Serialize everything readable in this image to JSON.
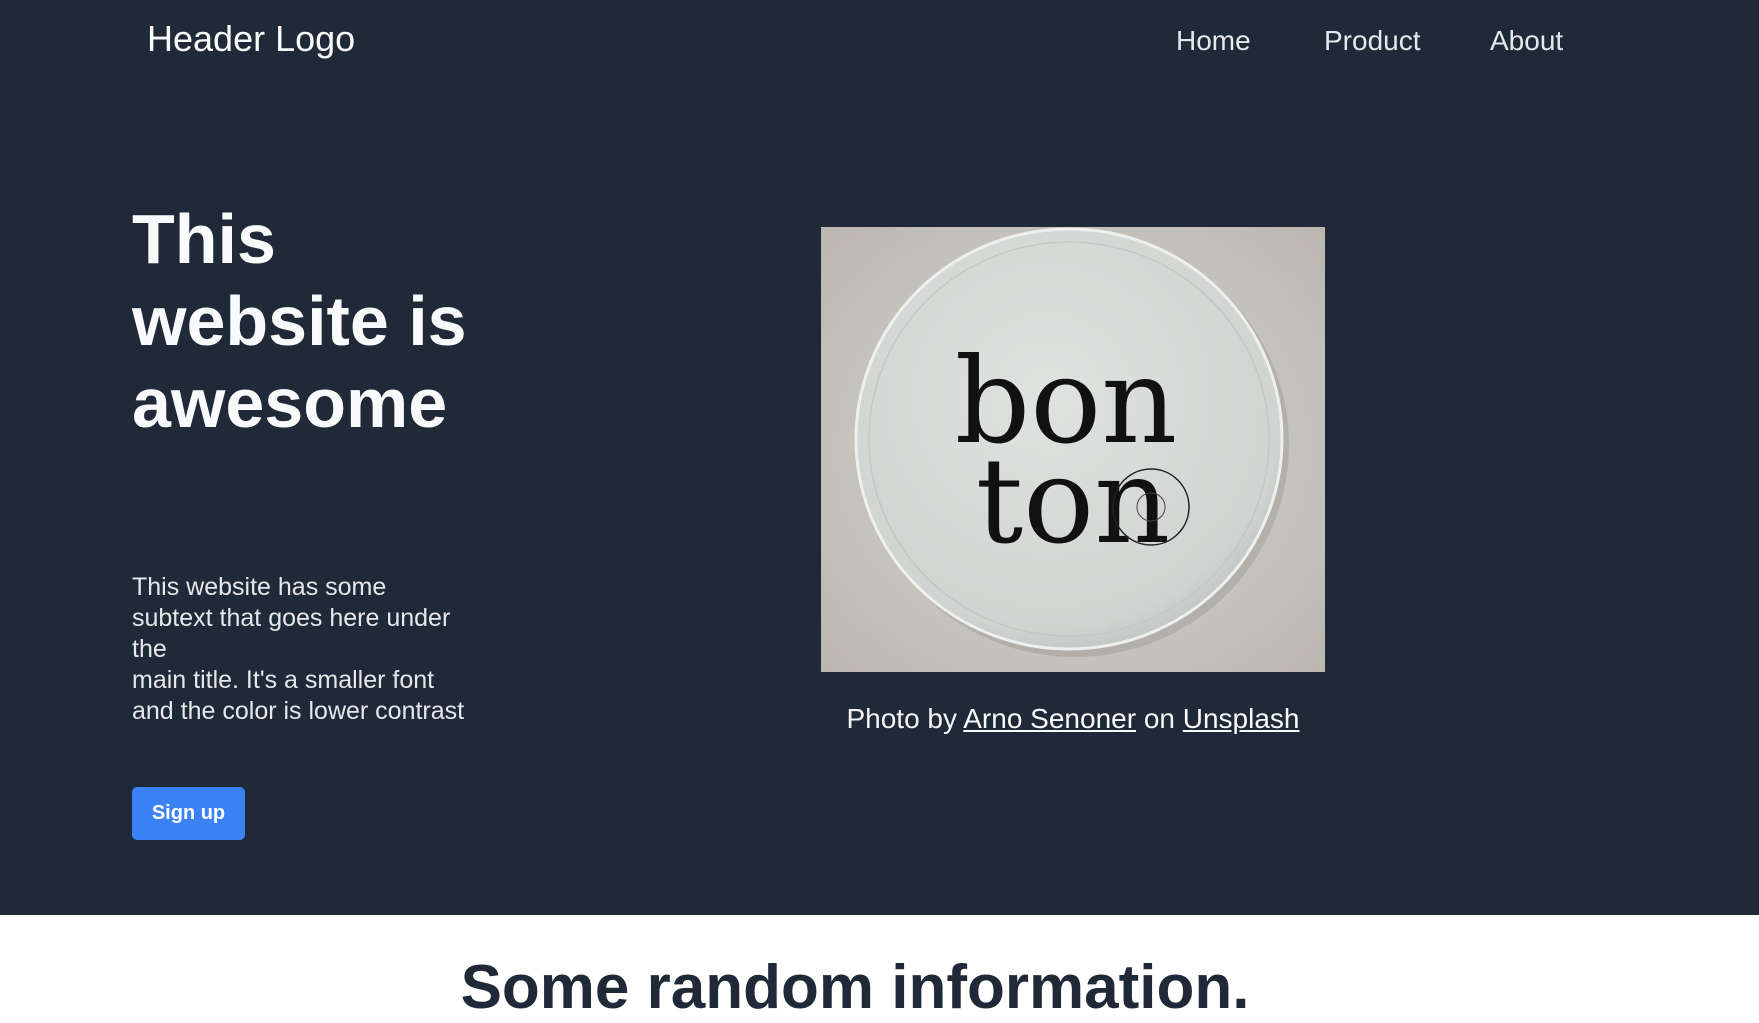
{
  "header": {
    "logo": "Header Logo",
    "nav": [
      {
        "label": "Home"
      },
      {
        "label": "Product"
      },
      {
        "label": "About"
      }
    ]
  },
  "hero": {
    "title": "This website is awesome",
    "subtext": "This website has some subtext that goes here under the\nmain title. It's a smaller font and the color is lower contrast",
    "signup_label": "Sign up",
    "image": {
      "word_top": "bon",
      "word_bottom": "ton"
    },
    "credit": {
      "prefix": "Photo by",
      "author": "Arno Senoner",
      "middle": "on",
      "source": "Unsplash"
    }
  },
  "info": {
    "heading": "Some random information."
  },
  "colors": {
    "hero_background": "#1f2937",
    "button": "#3b82f6",
    "heading_dark": "#1f2937"
  }
}
